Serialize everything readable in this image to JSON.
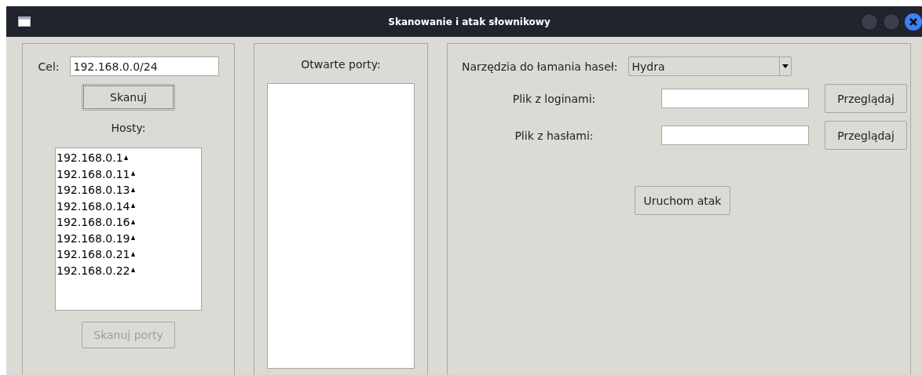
{
  "window": {
    "title": "Skanowanie i atak słownikowy"
  },
  "scan_panel": {
    "target_label": "Cel:",
    "target_value": "192.168.0.0/24",
    "scan_button": {
      "label": "Skanuj",
      "focused": true,
      "disabled": false
    },
    "hosts_label": "Hosty:",
    "hosts": [
      "192.168.0.1",
      "192.168.0.11",
      "192.168.0.13",
      "192.168.0.14",
      "192.168.0.16",
      "192.168.0.19",
      "192.168.0.21",
      "192.168.0.22"
    ],
    "port_scan_button": {
      "label": "Skanuj porty",
      "focused": false,
      "disabled": true
    }
  },
  "ports_panel": {
    "label": "Otwarte porty:"
  },
  "attack_panel": {
    "tool_label": "Narzędzia do łamania haseł:",
    "tool_value": "Hydra",
    "files": [
      {
        "label": "Plik z loginami:",
        "button": "Przeglądaj"
      },
      {
        "label": "Plik z hasłami:",
        "button": "Przeglądaj"
      }
    ],
    "run_button": "Uruchom atak"
  }
}
